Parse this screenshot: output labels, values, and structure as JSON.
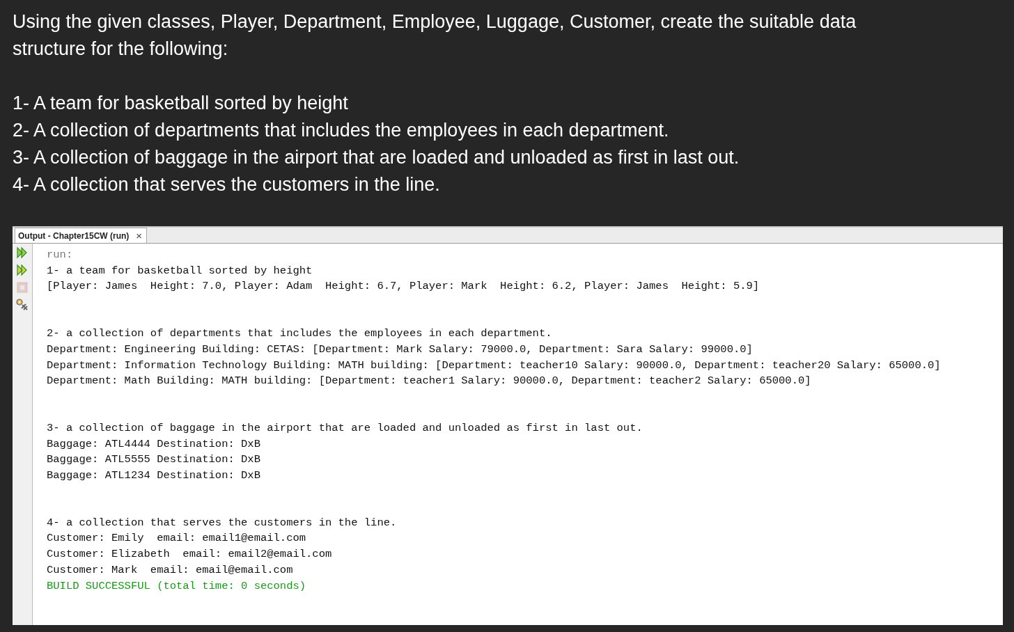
{
  "question": {
    "intro": "Using the given classes, Player, Department, Employee, Luggage, Customer, create the suitable data structure for the following:",
    "items": [
      "1- A team for basketball sorted by height",
      "2- A collection of departments that includes the employees in each department.",
      "3- A collection of baggage in the airport that are loaded and unloaded as first in last out.",
      "4- A collection that serves the customers in the line."
    ]
  },
  "output_panel": {
    "tab": {
      "label": "Output - Chapter15CW (run)",
      "close": "×",
      "selected": true
    },
    "toolbar": [
      {
        "kind": "rerun",
        "disabled": false
      },
      {
        "kind": "rerun-modified",
        "disabled": false
      },
      {
        "kind": "stop",
        "disabled": true
      },
      {
        "kind": "settings",
        "disabled": false
      }
    ],
    "blocks": [
      [
        {
          "kind": "run",
          "text": "run:"
        },
        {
          "kind": "normal",
          "text": "1- a team for basketball sorted by height"
        },
        {
          "kind": "normal",
          "text": "[Player: James  Height: 7.0, Player: Adam  Height: 6.7, Player: Mark  Height: 6.2, Player: James  Height: 5.9]"
        }
      ],
      [
        {
          "kind": "normal",
          "text": "2- a collection of departments that includes the employees in each department."
        },
        {
          "kind": "normal",
          "text": "Department: Engineering Building: CETAS: [Department: Mark Salary: 79000.0, Department: Sara Salary: 99000.0]"
        },
        {
          "kind": "normal",
          "text": "Department: Information Technology Building: MATH building: [Department: teacher10 Salary: 90000.0, Department: teacher20 Salary: 65000.0]"
        },
        {
          "kind": "normal",
          "text": "Department: Math Building: MATH building: [Department: teacher1 Salary: 90000.0, Department: teacher2 Salary: 65000.0]"
        }
      ],
      [
        {
          "kind": "normal",
          "text": "3- a collection of baggage in the airport that are loaded and unloaded as first in last out."
        },
        {
          "kind": "normal",
          "text": "Baggage: ATL4444 Destination: DxB"
        },
        {
          "kind": "normal",
          "text": "Baggage: ATL5555 Destination: DxB"
        },
        {
          "kind": "normal",
          "text": "Baggage: ATL1234 Destination: DxB"
        }
      ],
      [
        {
          "kind": "normal",
          "text": "4- a collection that serves the customers in the line."
        },
        {
          "kind": "normal",
          "text": "Customer: Emily  email: email1@email.com"
        },
        {
          "kind": "normal",
          "text": "Customer: Elizabeth  email: email2@email.com"
        },
        {
          "kind": "normal",
          "text": "Customer: Mark  email: email@email.com"
        },
        {
          "kind": "success",
          "text": "BUILD SUCCESSFUL (total time: 0 seconds)"
        }
      ]
    ]
  }
}
